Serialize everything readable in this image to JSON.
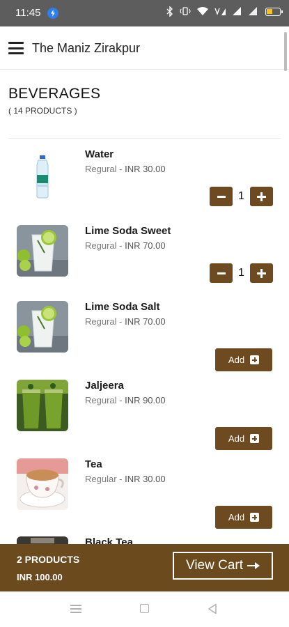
{
  "status_bar": {
    "time": "11:45",
    "icons": [
      "messenger-icon",
      "bluetooth-icon",
      "vibrate-icon",
      "wifi-icon",
      "volte-icon",
      "signal-icon",
      "signal-icon",
      "battery-icon"
    ]
  },
  "app": {
    "title": "The Maniz Zirakpur",
    "menu_icon": "hamburger-menu-icon"
  },
  "category": {
    "title": "BEVERAGES",
    "count": "( 14 PRODUCTS )"
  },
  "products": [
    {
      "name": "Water",
      "variant": "Regural - ",
      "price": "INR 30.00",
      "quantity": "1",
      "in_cart": true
    },
    {
      "name": "Lime Soda Sweet",
      "variant": "Regural - ",
      "price": "INR 70.00",
      "quantity": "1",
      "in_cart": true
    },
    {
      "name": "Lime Soda Salt",
      "variant": "Regural - ",
      "price": "INR 70.00",
      "add_label": "Add",
      "in_cart": false
    },
    {
      "name": "Jaljeera",
      "variant": "Regural - ",
      "price": "INR 90.00",
      "add_label": "Add",
      "in_cart": false
    },
    {
      "name": "Tea",
      "variant": "Regular - ",
      "price": "INR 30.00",
      "add_label": "Add",
      "in_cart": false
    },
    {
      "name": "Black Tea"
    }
  ],
  "cart": {
    "count": "2 PRODUCTS",
    "total": "INR 100.00",
    "button_label": "View Cart"
  },
  "colors": {
    "brand": "#6b4b1e",
    "status_bar": "#5d5d5d"
  }
}
